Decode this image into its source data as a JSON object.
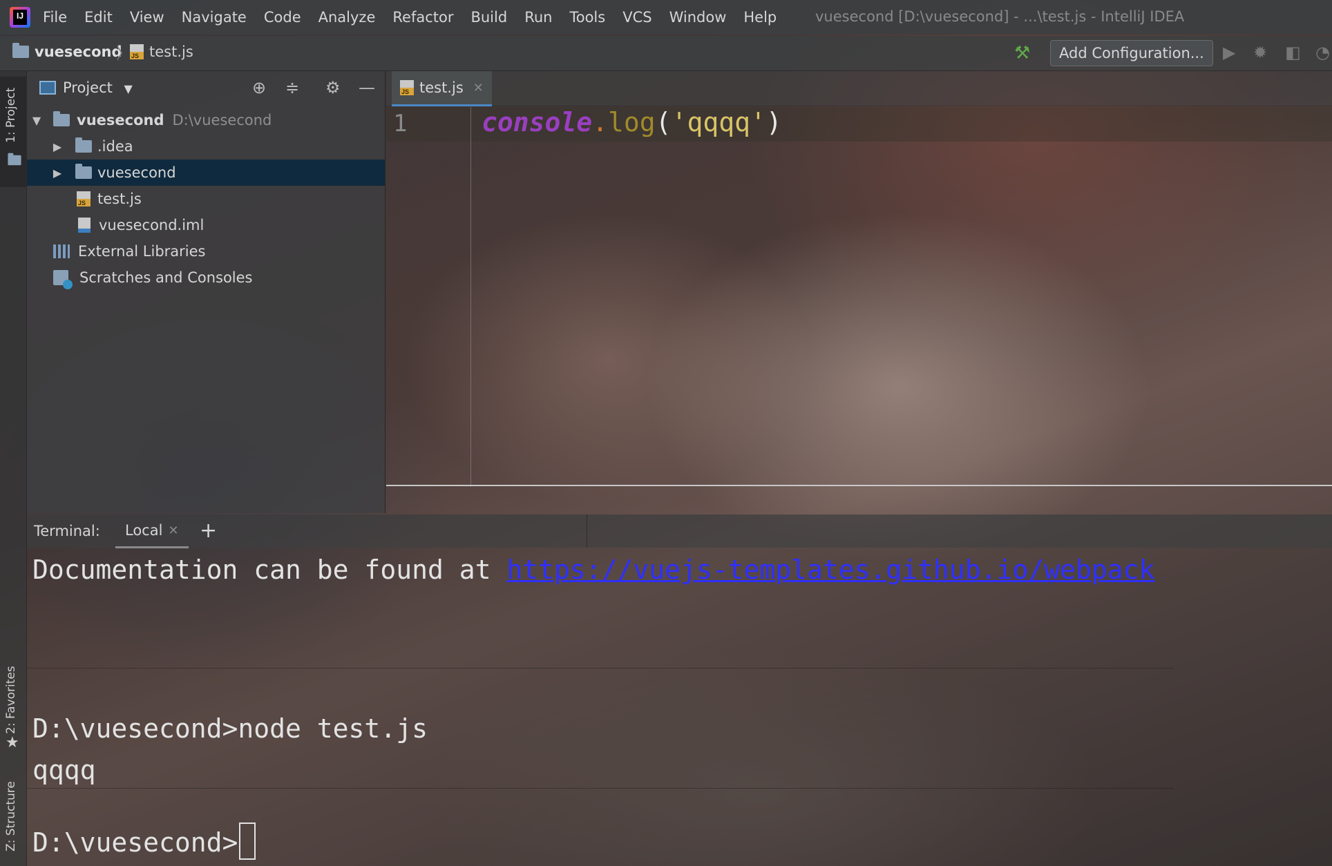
{
  "menubar": {
    "items": [
      "File",
      "Edit",
      "View",
      "Navigate",
      "Code",
      "Analyze",
      "Refactor",
      "Build",
      "Run",
      "Tools",
      "VCS",
      "Window",
      "Help"
    ],
    "window_title": "vuesecond [D:\\vuesecond] - ...\\test.js - IntelliJ IDEA"
  },
  "navbar": {
    "project": "vuesecond",
    "file": "test.js",
    "add_configuration": "Add Configuration..."
  },
  "tool_strip": {
    "project_tab": "1: Project",
    "favorites_tab": "2: Favorites",
    "structure_tab": "Z: Structure"
  },
  "project_panel": {
    "title": "Project",
    "root_name": "vuesecond",
    "root_path": "D:\\vuesecond",
    "items": [
      {
        "label": ".idea"
      },
      {
        "label": "vuesecond"
      },
      {
        "label": "test.js"
      },
      {
        "label": "vuesecond.iml"
      },
      {
        "label": "External Libraries"
      },
      {
        "label": "Scratches and Consoles"
      }
    ]
  },
  "editor": {
    "tab": "test.js",
    "line_number": "1",
    "code": {
      "object": "console",
      "dot": ".",
      "fn": "log",
      "open": "(",
      "string": "'qqqq'",
      "close": ")"
    }
  },
  "terminal": {
    "label": "Terminal:",
    "tab": "Local",
    "add": "+",
    "doc_prefix": "Documentation can be found at ",
    "doc_link": "https://vuejs-templates.github.io/webpack",
    "command_line": "D:\\vuesecond>node test.js",
    "output": "qqqq",
    "prompt": "D:\\vuesecond>"
  }
}
